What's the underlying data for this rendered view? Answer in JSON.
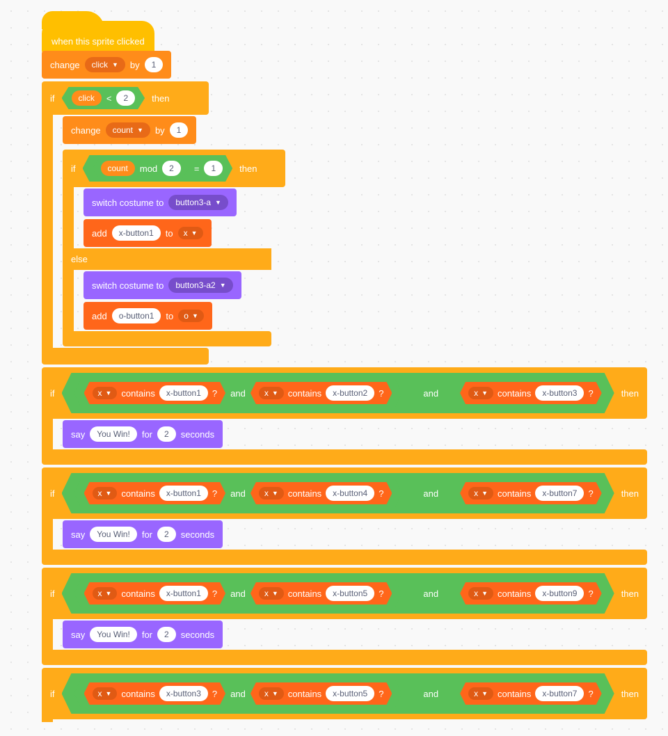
{
  "hat": {
    "label": "when this sprite clicked"
  },
  "labels": {
    "change": "change",
    "by": "by",
    "if": "if",
    "then": "then",
    "else": "else",
    "mod": "mod",
    "eq": "=",
    "lt": "<",
    "switch": "switch costume to",
    "add": "add",
    "to": "to",
    "say": "say",
    "for": "for",
    "seconds": "seconds",
    "contains": "contains",
    "q": "?",
    "and": "and"
  },
  "vars": {
    "click": "click",
    "count": "count",
    "x": "x",
    "o": "o"
  },
  "nums": {
    "one": "1",
    "two": "2"
  },
  "costumes": {
    "a": "button3-a",
    "a2": "button3-a2"
  },
  "listitems": {
    "xb1": "x-button1",
    "ob1": "o-button1"
  },
  "say": {
    "win": "You Win!"
  },
  "checks": [
    {
      "a": "x-button1",
      "b": "x-button2",
      "c": "x-button3"
    },
    {
      "a": "x-button1",
      "b": "x-button4",
      "c": "x-button7"
    },
    {
      "a": "x-button1",
      "b": "x-button5",
      "c": "x-button9"
    },
    {
      "a": "x-button3",
      "b": "x-button5",
      "c": "x-button7"
    }
  ]
}
